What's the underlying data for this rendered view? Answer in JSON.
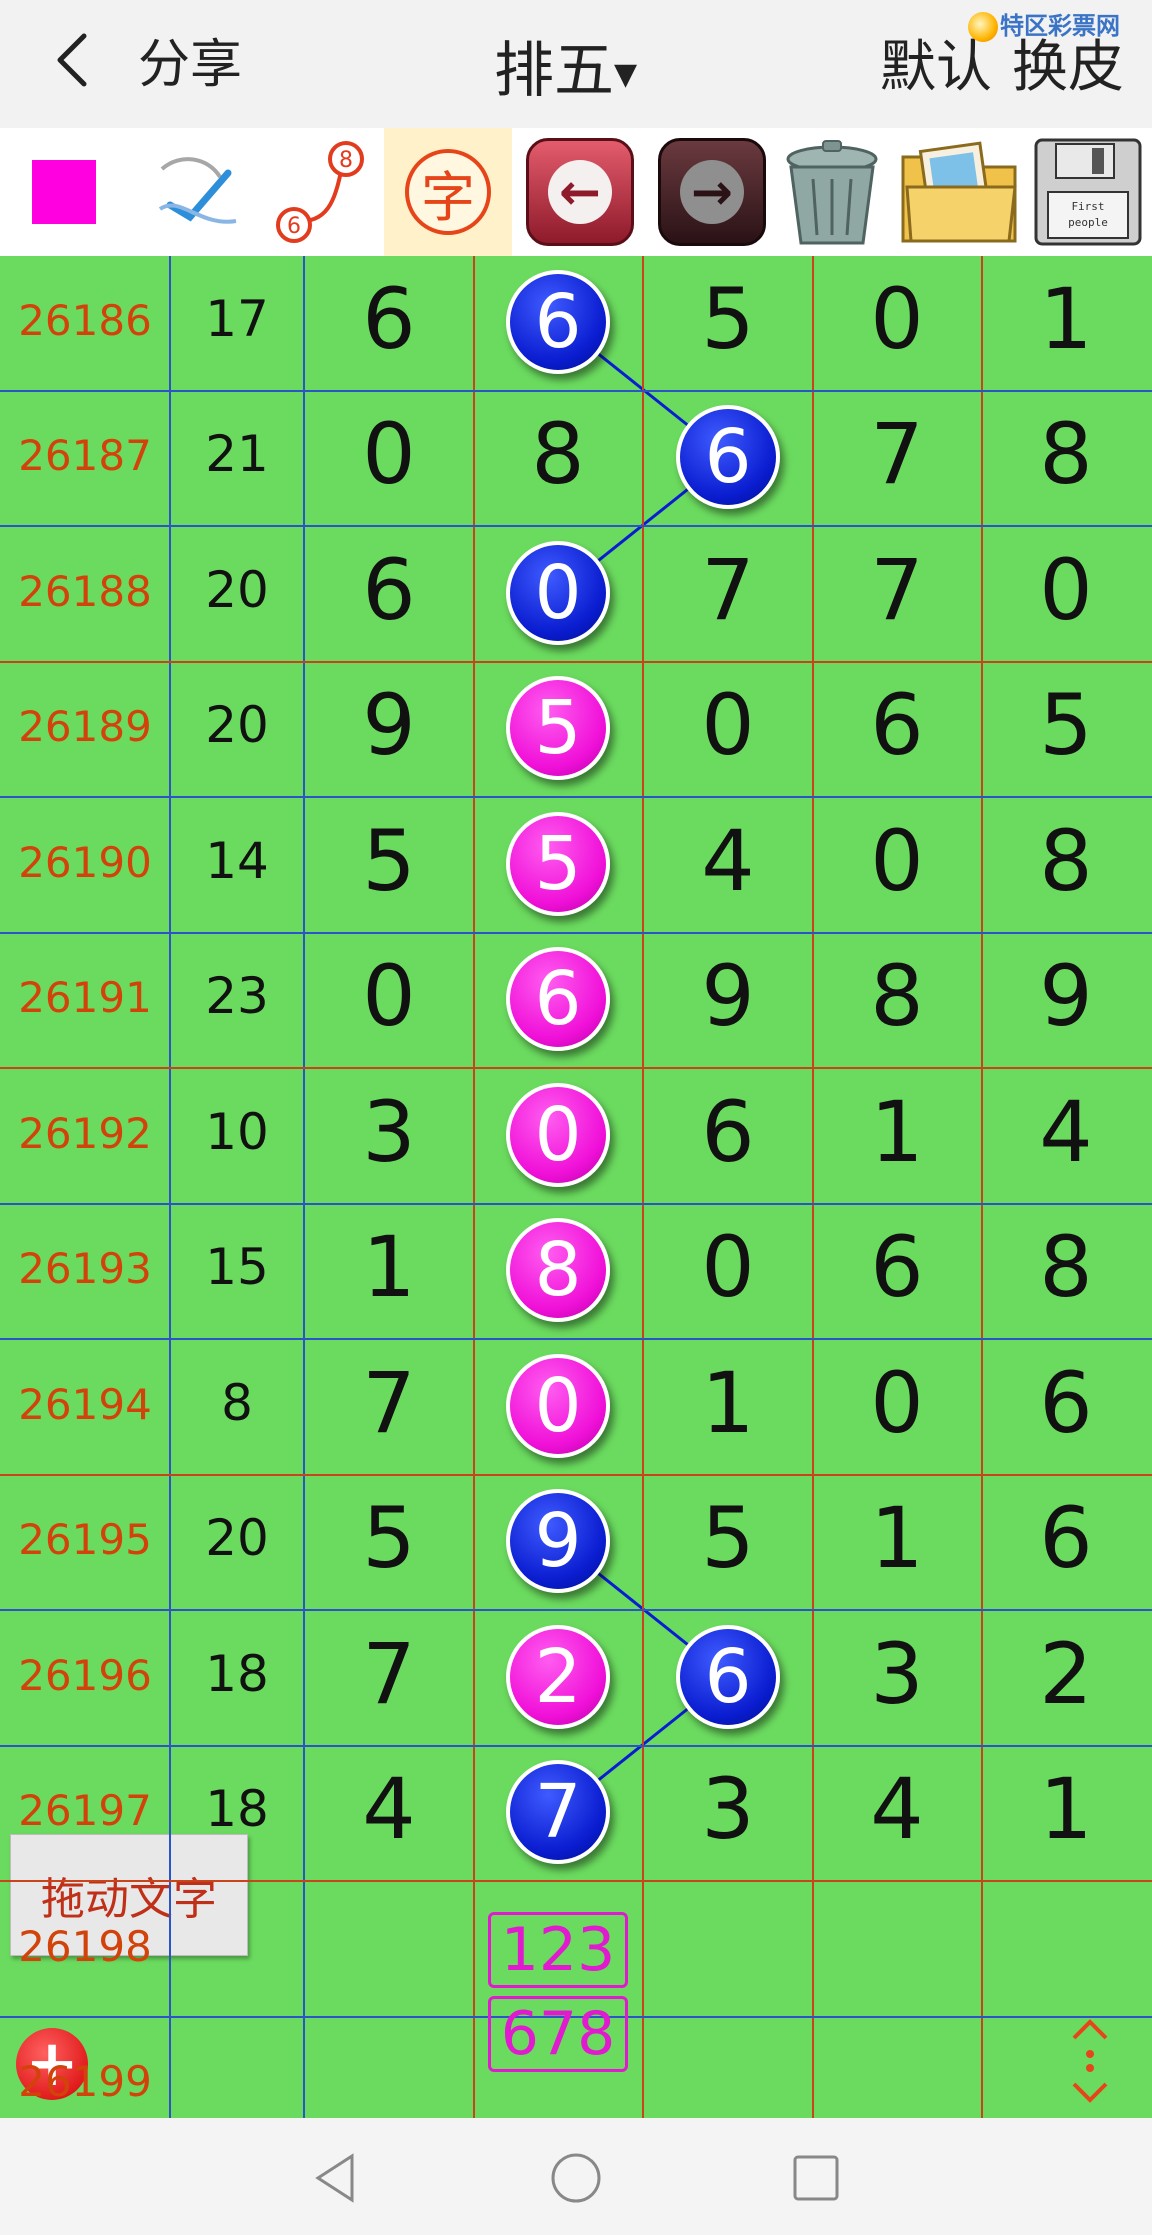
{
  "header": {
    "share_label": "分享",
    "title": "排五",
    "default_label": "默认",
    "skin_label": "换皮",
    "watermark": "特区彩票网"
  },
  "toolbar": {
    "color_swatch": "#ff00e0",
    "tools": [
      "color-swatch-icon",
      "draw-line-icon",
      "connect-numbers-icon",
      "text-char-icon",
      "undo-icon",
      "redo-icon",
      "trash-icon",
      "picture-folder-icon",
      "save-disk-icon"
    ],
    "connect_icon_numbers": [
      "8",
      "6"
    ],
    "char_label": "字",
    "disk_label": "First people"
  },
  "table": {
    "rows": [
      {
        "issue": "26186",
        "sum": "17",
        "digits": [
          "6",
          "6",
          "5",
          "0",
          "1"
        ]
      },
      {
        "issue": "26187",
        "sum": "21",
        "digits": [
          "0",
          "8",
          "6",
          "7",
          "8"
        ]
      },
      {
        "issue": "26188",
        "sum": "20",
        "digits": [
          "6",
          "0",
          "7",
          "7",
          "0"
        ]
      },
      {
        "issue": "26189",
        "sum": "20",
        "digits": [
          "9",
          "5",
          "0",
          "6",
          "5"
        ]
      },
      {
        "issue": "26190",
        "sum": "14",
        "digits": [
          "5",
          "5",
          "4",
          "0",
          "8"
        ]
      },
      {
        "issue": "26191",
        "sum": "23",
        "digits": [
          "0",
          "6",
          "9",
          "8",
          "9"
        ]
      },
      {
        "issue": "26192",
        "sum": "10",
        "digits": [
          "3",
          "0",
          "6",
          "1",
          "4"
        ]
      },
      {
        "issue": "26193",
        "sum": "15",
        "digits": [
          "1",
          "8",
          "0",
          "6",
          "8"
        ]
      },
      {
        "issue": "26194",
        "sum": "8",
        "digits": [
          "7",
          "0",
          "1",
          "0",
          "6"
        ]
      },
      {
        "issue": "26195",
        "sum": "20",
        "digits": [
          "5",
          "9",
          "5",
          "1",
          "6"
        ]
      },
      {
        "issue": "26196",
        "sum": "18",
        "digits": [
          "7",
          "2",
          "6",
          "3",
          "2"
        ]
      },
      {
        "issue": "26197",
        "sum": "18",
        "digits": [
          "4",
          "7",
          "3",
          "4",
          "1"
        ]
      },
      {
        "issue": "26198",
        "sum": "",
        "digits": [
          "",
          "",
          "",
          "",
          ""
        ]
      },
      {
        "issue": "26199",
        "sum": "",
        "digits": [
          "",
          "",
          "",
          "",
          ""
        ]
      }
    ],
    "balls": [
      {
        "row": 0,
        "col": 1,
        "color": "blue"
      },
      {
        "row": 1,
        "col": 2,
        "color": "blue"
      },
      {
        "row": 2,
        "col": 1,
        "color": "blue"
      },
      {
        "row": 3,
        "col": 1,
        "color": "pink"
      },
      {
        "row": 4,
        "col": 1,
        "color": "pink"
      },
      {
        "row": 5,
        "col": 1,
        "color": "pink"
      },
      {
        "row": 6,
        "col": 1,
        "color": "pink"
      },
      {
        "row": 7,
        "col": 1,
        "color": "pink"
      },
      {
        "row": 8,
        "col": 1,
        "color": "pink"
      },
      {
        "row": 9,
        "col": 1,
        "color": "blue"
      },
      {
        "row": 10,
        "col": 1,
        "color": "pink"
      },
      {
        "row": 10,
        "col": 2,
        "color": "blue"
      },
      {
        "row": 11,
        "col": 1,
        "color": "blue"
      }
    ],
    "links": [
      [
        [
          0,
          1
        ],
        [
          1,
          2
        ],
        [
          2,
          1
        ]
      ],
      [
        [
          9,
          1
        ],
        [
          10,
          2
        ],
        [
          11,
          1
        ]
      ]
    ],
    "filter_boxes": [
      "123",
      "678"
    ]
  },
  "overlay": {
    "drag_text_label": "拖动文字",
    "add_label": "+"
  },
  "colors": {
    "grid_bg": "#6bdb5f",
    "issue_text": "#d2430b",
    "blue_ball": "#0a1dd0",
    "pink_ball": "#f010d8",
    "filter_box": "#e11ad0",
    "col_line_blue": "#2b54c8",
    "col_line_red": "#c8441a"
  }
}
